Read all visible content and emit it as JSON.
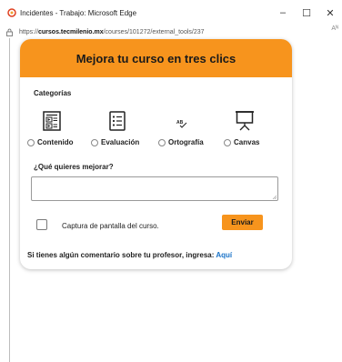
{
  "window": {
    "title": "Incidentes - Trabajo: Microsoft Edge",
    "minimize": "–",
    "maximize": "☐",
    "close": "✕"
  },
  "urlbar": {
    "prefix": "https://",
    "host": "cursos.tecmilenio.mx",
    "path": "/courses/101272/external_tools/237",
    "reader_icon": "Aᴺ"
  },
  "card": {
    "title": "Mejora tu curso en tres clics",
    "categories_label": "Categorías",
    "categories": [
      {
        "label": "Contenido",
        "icon": "content-icon"
      },
      {
        "label": "Evaluación",
        "icon": "checklist-icon"
      },
      {
        "label": "Ortografía",
        "icon": "spellcheck-icon"
      },
      {
        "label": "Canvas",
        "icon": "presentation-icon"
      }
    ],
    "question_label": "¿Qué quieres mejorar?",
    "textarea_value": "",
    "checkbox_label": "Captura de pantalla del curso.",
    "send_label": "Enviar",
    "comment_text": "Si tienes algún comentario sobre tu profesor, ingresa:",
    "comment_link": "Aquí"
  },
  "colors": {
    "accent": "#f7941d",
    "link": "#1a73c8"
  }
}
